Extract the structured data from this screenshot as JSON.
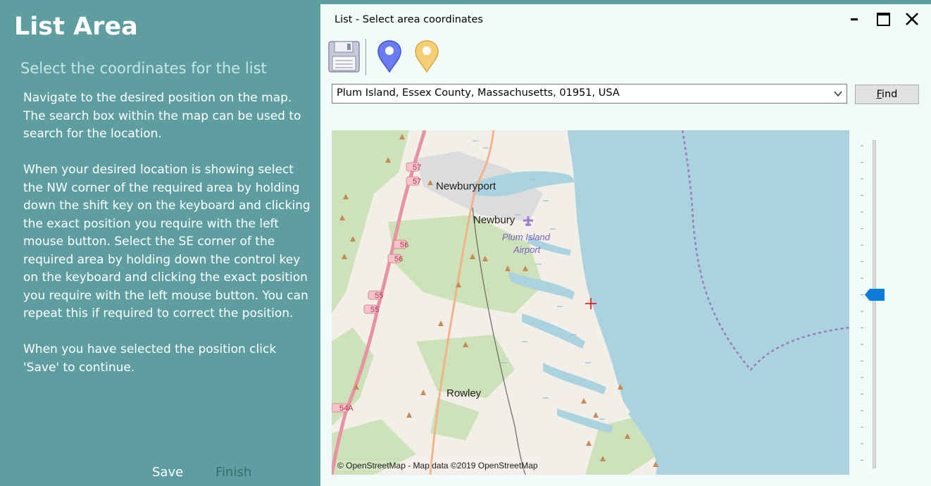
{
  "left_panel": {
    "title": "List Area",
    "subtitle": "Select the coordinates for the list",
    "paragraphs": [
      "Navigate to the desired position on the map. The search box within the map can be used to search for the location.",
      "When your desired location is showing select the NW corner of the required area by holding down the shift key on the keyboard and clicking the exact position you require with the left mouse button.  Select the SE corner of the required area by holding down the control key on the keyboard and clicking the exact position you require with the left mouse button. You can repeat this if required to correct the position.",
      "When you have selected the position click 'Save' to continue."
    ],
    "save_label": "Save",
    "finish_label": "Finish"
  },
  "window": {
    "title": "List - Select area coordinates",
    "search_value": "Plum Island, Essex County, Massachusetts, 01951, USA",
    "find_label_underlined": "F",
    "find_label_rest": "ind"
  },
  "map": {
    "labels": {
      "newburyport": "Newburyport",
      "newbury": "Newbury",
      "airport_line1": "Plum Island",
      "airport_line2": "Airport",
      "rowley": "Rowley",
      "road_57a": "57",
      "road_57b": "57",
      "road_56a": "56",
      "road_56b": "56",
      "road_55a": "55",
      "road_55b": "55",
      "road_54a": "54A"
    },
    "attribution": "© OpenStreetMap - Map data ©2019 OpenStreetMap",
    "colors": {
      "water": "#aad3df",
      "land": "#f2efe9",
      "green": "#cde2b8",
      "urban": "#dddddd",
      "marker_accent": "#e60000"
    }
  },
  "colors": {
    "panel_bg": "#5f9ea0",
    "window_bg": "#f0fbfa",
    "zoom_thumb": "#0a7bd8"
  }
}
